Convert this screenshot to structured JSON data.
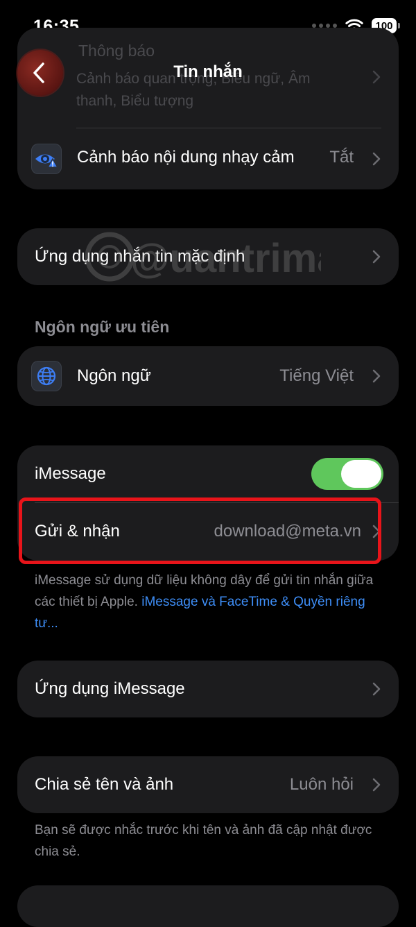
{
  "status": {
    "time": "16:35",
    "battery": "100"
  },
  "nav": {
    "title": "Tin nhắn"
  },
  "faded_card": {
    "line1": "Thông báo",
    "line2": "Cảnh báo quan trọng, Biểu ngữ, Âm",
    "line3": "thanh, Biểu tượng"
  },
  "sensitive": {
    "label": "Cảnh báo nội dung nhạy cảm",
    "value": "Tắt"
  },
  "default_app": {
    "label": "Ứng dụng nhắn tin mặc định"
  },
  "language_section": {
    "header": "Ngôn ngữ ưu tiên",
    "label": "Ngôn ngữ",
    "value": "Tiếng Việt"
  },
  "imessage": {
    "label": "iMessage",
    "toggle_on": true,
    "send_receive_label": "Gửi & nhận",
    "send_receive_value": "download@meta.vn",
    "footnote_text": "iMessage sử dụng dữ liệu không dây để gửi tin nhắn giữa các thiết bị Apple. ",
    "footnote_link": "iMessage và FaceTime & Quyền riêng tư..."
  },
  "imessage_apps": {
    "label": "Ứng dụng iMessage"
  },
  "share_name": {
    "label": "Chia sẻ tên và ảnh",
    "value": "Luôn hỏi"
  },
  "share_footnote": "Bạn sẽ được nhắc trước khi tên và ảnh đã cập nhật được chia sẻ.",
  "watermark": "@uantrimang",
  "colors": {
    "accent_blue": "#3e8ef7",
    "toggle_green": "#5fc75c",
    "highlight_red": "#e8141a"
  }
}
